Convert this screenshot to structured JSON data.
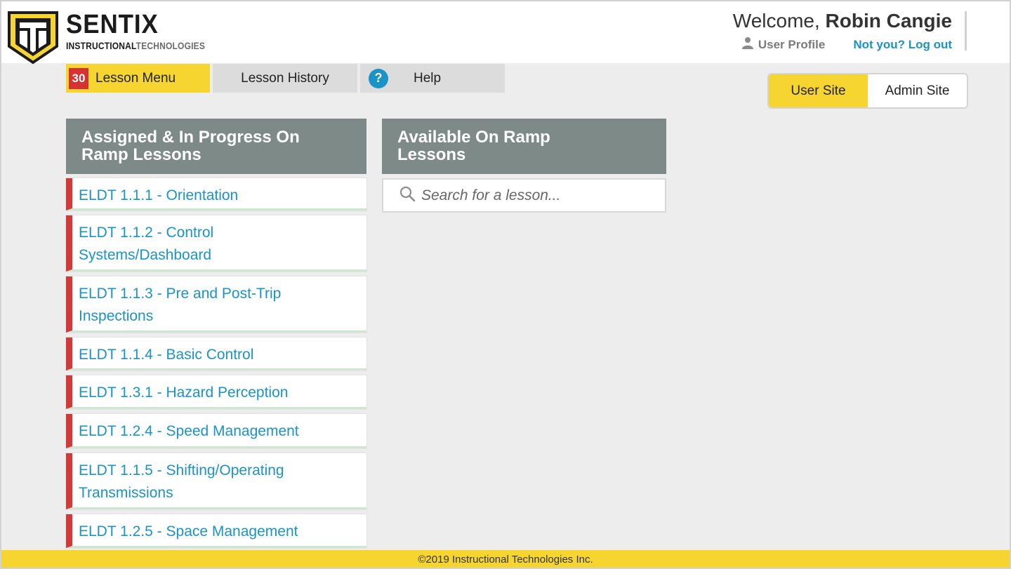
{
  "brand": {
    "name": "SENTIX",
    "subtitle_bold": "INSTRUCTIONAL",
    "subtitle_light": "TECHNOLOGIES",
    "colors": {
      "primary": "#f7d531",
      "dark": "#1b1b1b"
    }
  },
  "header": {
    "welcome_prefix": "Welcome, ",
    "user_name": "Robin Cangie",
    "profile_label": "User Profile",
    "logout_label": "Not you? Log out"
  },
  "nav": {
    "lesson_count": "30",
    "tabs": [
      {
        "label": "Lesson Menu",
        "active": true
      },
      {
        "label": "Lesson History",
        "active": false
      },
      {
        "label": "Help",
        "active": false,
        "icon": "help-icon",
        "icon_glyph": "?"
      }
    ]
  },
  "site_switch": {
    "user_site": "User Site",
    "admin_site": "Admin Site",
    "active": "User Site"
  },
  "assigned": {
    "title": "Assigned & In Progress On Ramp Lessons",
    "lessons": [
      "ELDT 1.1.1 - Orientation",
      "ELDT 1.1.2 - Control Systems/Dashboard",
      "ELDT 1.1.3 - Pre and Post-Trip Inspections",
      "ELDT 1.1.4 - Basic Control",
      "ELDT 1.3.1 - Hazard Perception",
      "ELDT 1.2.4 - Speed Management",
      "ELDT 1.1.5 - Shifting/Operating Transmissions",
      "ELDT 1.2.5 - Space Management"
    ]
  },
  "available": {
    "title": "Available On Ramp Lessons",
    "search_placeholder": "Search for a lesson..."
  },
  "footer": {
    "copyright": "©2019 Instructional Technologies Inc."
  }
}
